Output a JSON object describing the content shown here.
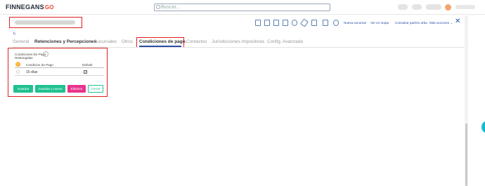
{
  "app": {
    "brand": "FINNEGANS",
    "brand_suffix": "GO"
  },
  "search": {
    "placeholder": "Buscar..."
  },
  "toolbar": {
    "icons": [
      "new-document-icon",
      "save-icon",
      "print-icon",
      "calendar-icon",
      "history-icon",
      "attach-icon",
      "copy-icon",
      "document-icon",
      "comment-icon"
    ],
    "links": [
      "Nueva sucursal",
      "Ver en mapa",
      "Consultar padrón arba",
      "Más acciones"
    ]
  },
  "tabs": [
    "General",
    "Retenciones y Percepciones",
    "Sucursales",
    "Otros",
    "Condiciones de pago",
    "Contactos",
    "Jurisdicciones Impositivas",
    "Config. Avanzada"
  ],
  "active_tab": "Condiciones de pago",
  "form": {
    "restricted_label": "Condiciones De Pago Restringidas",
    "table": {
      "col_condition": "Condicion de Pago",
      "col_default": "Default",
      "rows": [
        {
          "condition": "15 días",
          "default": true
        }
      ]
    },
    "check_mark": "✓"
  },
  "buttons": {
    "save": "Guardar",
    "save_new": "Guardar y nuevo",
    "delete": "Eliminar",
    "cancel": "Cerrar"
  },
  "refresh_glyph": "↻",
  "close_glyph": "✕",
  "colors": {
    "accent_red": "#e02020",
    "link_blue": "#2a4fa8",
    "btn_green": "#1fc28f",
    "btn_pink": "#e8348c"
  }
}
